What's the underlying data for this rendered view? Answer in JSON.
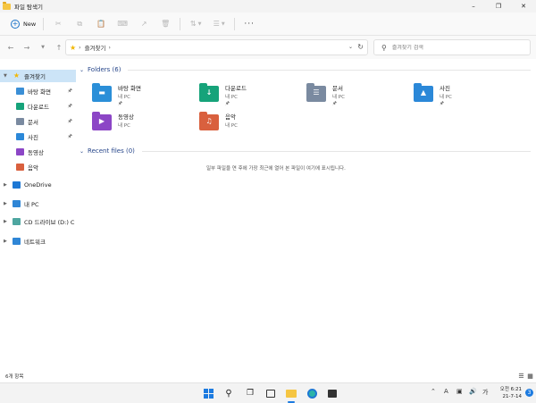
{
  "window": {
    "title": "파일 탐색기",
    "controls": [
      "minimize-icon",
      "maximize-icon",
      "close-icon"
    ]
  },
  "toolbar": {
    "new_label": "New",
    "icons": [
      "cut-icon",
      "copy-icon",
      "paste-icon",
      "rename-icon",
      "share-icon",
      "delete-icon",
      "sort-icon",
      "view-icon",
      "more-icon"
    ]
  },
  "address": {
    "crumb": "즐겨찾기",
    "chevron": "›",
    "search_placeholder": "즐겨찾기 검색"
  },
  "sidebar": {
    "items": [
      {
        "label": "즐겨찾기",
        "icon": "star-icon",
        "selected": true
      },
      {
        "label": "바탕 화면",
        "icon": "desktop-icon",
        "pinned": true
      },
      {
        "label": "다운로드",
        "icon": "download-icon",
        "pinned": true
      },
      {
        "label": "문서",
        "icon": "documents-icon",
        "pinned": true
      },
      {
        "label": "사진",
        "icon": "pictures-icon",
        "pinned": true
      },
      {
        "label": "동영상",
        "icon": "videos-icon"
      },
      {
        "label": "음악",
        "icon": "music-icon"
      },
      {
        "label": "OneDrive",
        "icon": "onedrive-icon"
      },
      {
        "label": "내 PC",
        "icon": "pc-icon"
      },
      {
        "label": "CD 드라이브 (D:) C",
        "icon": "cd-drive-icon"
      },
      {
        "label": "네트워크",
        "icon": "network-icon"
      }
    ]
  },
  "main": {
    "folders_header": "Folders (6)",
    "recent_header": "Recent files (0)",
    "empty_message": "일부 파일을 연 후에 가장 최근에 열어 본 파일이 여기에 표시됩니다.",
    "folders": [
      {
        "name": "바탕 화면",
        "location": "내 PC",
        "pinned": true,
        "icon": "desktop-folder-icon",
        "color": "#2b8fd8"
      },
      {
        "name": "다운로드",
        "location": "내 PC",
        "pinned": true,
        "icon": "downloads-folder-icon",
        "color": "#16a37a"
      },
      {
        "name": "문서",
        "location": "내 PC",
        "pinned": true,
        "icon": "documents-folder-icon",
        "color": "#7a8aa0"
      },
      {
        "name": "사진",
        "location": "내 PC",
        "pinned": true,
        "icon": "pictures-folder-icon",
        "color": "#2b88d8"
      },
      {
        "name": "동영상",
        "location": "내 PC",
        "pinned": false,
        "icon": "videos-folder-icon",
        "color": "#8c46c6"
      },
      {
        "name": "음악",
        "location": "내 PC",
        "pinned": false,
        "icon": "music-folder-icon",
        "color": "#d9603e"
      }
    ]
  },
  "status": {
    "count": "6개 항목"
  },
  "taskbar": {
    "apps": [
      "start-icon",
      "search-icon",
      "task-view-icon",
      "widgets-icon",
      "file-explorer-icon",
      "edge-icon",
      "store-icon"
    ],
    "tray": [
      "chevron-up-icon",
      "font-icon",
      "monitor-icon",
      "volume-icon",
      "language-icon"
    ],
    "language": "A",
    "ime": "가",
    "time": "오전 6:21",
    "date": "21-7-14",
    "notification_count": "3"
  }
}
